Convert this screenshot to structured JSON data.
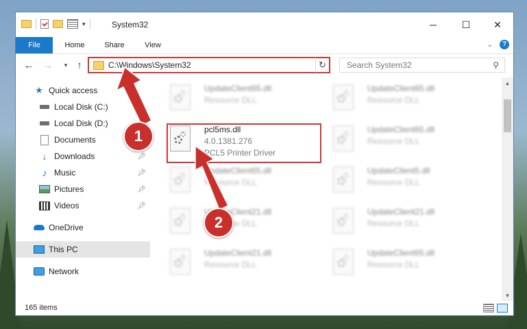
{
  "window": {
    "title": "System32",
    "controls": {
      "minimize": "─",
      "maximize": "☐",
      "close": "✕"
    }
  },
  "ribbon": {
    "tabs": [
      {
        "label": "File"
      },
      {
        "label": "Home"
      },
      {
        "label": "Share"
      },
      {
        "label": "View"
      }
    ]
  },
  "navigation": {
    "address": "C:\\Windows\\System32",
    "search_placeholder": "Search System32"
  },
  "sidebar": {
    "items": [
      {
        "label": "Quick access"
      },
      {
        "label": "Local Disk (C:)"
      },
      {
        "label": "Local Disk (D:)"
      },
      {
        "label": "Documents"
      },
      {
        "label": "Downloads"
      },
      {
        "label": "Music"
      },
      {
        "label": "Pictures"
      },
      {
        "label": "Videos"
      },
      {
        "label": "OneDrive"
      },
      {
        "label": "This PC"
      },
      {
        "label": "Network"
      }
    ]
  },
  "files": {
    "left_column": [
      {
        "name": "UpdateClient65.dll",
        "meta1": "Resource DLL",
        "meta2": ""
      },
      {
        "name": "pcl5ms.dll",
        "meta1": "4.0.1381.276",
        "meta2": "PCL5 Printer Driver"
      },
      {
        "name": "UpdateClient65.dll",
        "meta1": "Resource DLL",
        "meta2": ""
      },
      {
        "name": "UpdateClient21.dll",
        "meta1": "Resource DLL",
        "meta2": ""
      },
      {
        "name": "UpdateClient21.dll",
        "meta1": "Resource DLL",
        "meta2": ""
      }
    ],
    "right_column": [
      {
        "name": "UpdateClient65.dll",
        "meta1": "Resource DLL"
      },
      {
        "name": "UpdateClient65.dll",
        "meta1": "Resource DLL"
      },
      {
        "name": "UpdateClient5.dll",
        "meta1": "Resource DLL"
      },
      {
        "name": "UpdateClient21.dll",
        "meta1": "Resource DLL"
      },
      {
        "name": "UpdateClient65.dll",
        "meta1": "Resource DLL"
      }
    ]
  },
  "status": {
    "item_count": "165 items"
  },
  "annotations": {
    "step1": "1",
    "step2": "2",
    "color": "#c9302c"
  }
}
